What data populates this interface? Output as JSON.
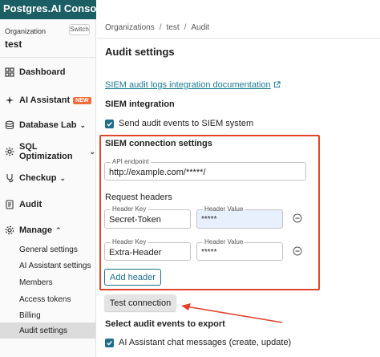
{
  "app": {
    "title": "Postgres.AI Console"
  },
  "sidebar": {
    "org_label": "Organization",
    "switch_label": "Switch",
    "org_name": "test",
    "items": [
      {
        "label": "Dashboard",
        "icon": "dashboard-icon"
      },
      {
        "label": "AI Assistant",
        "icon": "ai-assistant-icon",
        "badge": "NEW"
      },
      {
        "label": "Database Lab",
        "icon": "database-icon",
        "chevron": "⌄"
      },
      {
        "label": "SQL Optimization",
        "icon": "sql-optimization-icon",
        "chevron": "⌄"
      },
      {
        "label": "Checkup",
        "icon": "checkup-icon",
        "chevron": "⌄"
      },
      {
        "label": "Audit",
        "icon": "audit-icon"
      },
      {
        "label": "Manage",
        "icon": "gear-icon",
        "chevron": "⌃"
      }
    ],
    "sub_items": [
      {
        "label": "General settings"
      },
      {
        "label": "AI Assistant settings"
      },
      {
        "label": "Members"
      },
      {
        "label": "Access tokens"
      },
      {
        "label": "Billing"
      },
      {
        "label": "Audit settings",
        "active": true
      }
    ]
  },
  "breadcrumb": {
    "items": [
      "Organizations",
      "test",
      "Audit"
    ],
    "separator": "/"
  },
  "page": {
    "title": "Audit settings",
    "doc_link": "SIEM audit logs integration documentation",
    "siem_integration_heading": "SIEM integration",
    "send_events_label": "Send audit events to SIEM system",
    "send_events_checked": true
  },
  "siem_connection": {
    "title": "SIEM connection settings",
    "api_endpoint_label": "API endpoint",
    "api_endpoint_value": "http://example.com/*****/",
    "request_headers_label": "Request headers",
    "headers": [
      {
        "key_label": "Header Key",
        "key_value": "Secret-Token",
        "value_label": "Header Value",
        "value": "*****"
      },
      {
        "key_label": "Header Key",
        "key_value": "Extra-Header",
        "value_label": "Header Value",
        "value": "*****"
      }
    ],
    "add_header_label": "Add header"
  },
  "test_connection_label": "Test connection",
  "select_events_heading": "Select audit events to export",
  "events": [
    {
      "label": "AI Assistant chat messages (create, update)",
      "checked": true
    }
  ],
  "colors": {
    "brand": "#1b5e63",
    "accent": "#1f6e8c",
    "highlight": "#e0442c"
  }
}
